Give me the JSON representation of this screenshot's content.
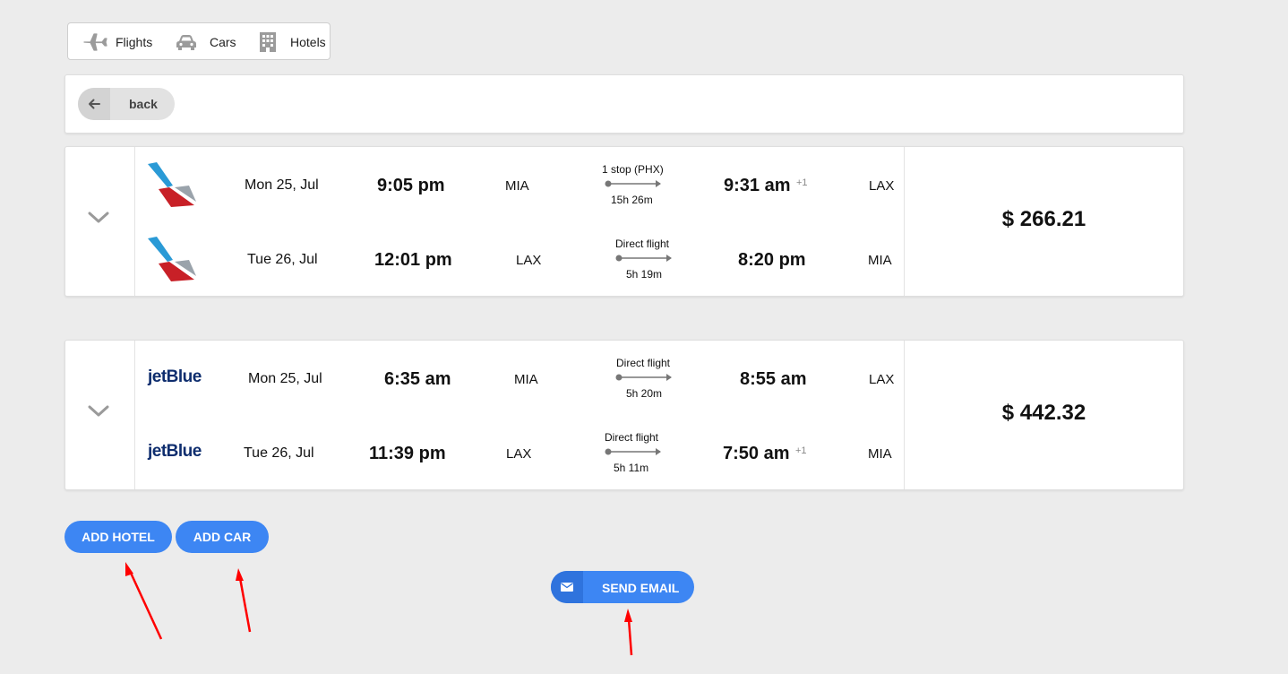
{
  "tabs": [
    {
      "label": "Flights",
      "icon": "plane-icon"
    },
    {
      "label": "Cars",
      "icon": "car-icon"
    },
    {
      "label": "Hotels",
      "icon": "building-icon"
    }
  ],
  "back_label": "back",
  "results": [
    {
      "airline": "American Airlines",
      "price": "$ 266.21",
      "legs": [
        {
          "date": "Mon 25, Jul",
          "depart_time": "9:05 pm",
          "from": "MIA",
          "stops": "1 stop (PHX)",
          "duration": "15h 26m",
          "arrive_time": "9:31 am",
          "day_offset": "+1",
          "to": "LAX"
        },
        {
          "date": "Tue 26, Jul",
          "depart_time": "12:01 pm",
          "from": "LAX",
          "stops": "Direct flight",
          "duration": "5h 19m",
          "arrive_time": "8:20 pm",
          "day_offset": "",
          "to": "MIA"
        }
      ]
    },
    {
      "airline": "jetBlue",
      "price": "$ 442.32",
      "legs": [
        {
          "date": "Mon 25, Jul",
          "depart_time": "6:35 am",
          "from": "MIA",
          "stops": "Direct flight",
          "duration": "5h 20m",
          "arrive_time": "8:55 am",
          "day_offset": "",
          "to": "LAX"
        },
        {
          "date": "Tue 26, Jul",
          "depart_time": "11:39 pm",
          "from": "LAX",
          "stops": "Direct flight",
          "duration": "5h 11m",
          "arrive_time": "7:50 am",
          "day_offset": "+1",
          "to": "MIA"
        }
      ]
    }
  ],
  "buttons": {
    "add_hotel": "ADD HOTEL",
    "add_car": "ADD CAR",
    "send_email": "SEND EMAIL"
  },
  "colors": {
    "accent": "#3d86f3",
    "annotation_arrow": "#ff0000",
    "background": "#ececec"
  }
}
